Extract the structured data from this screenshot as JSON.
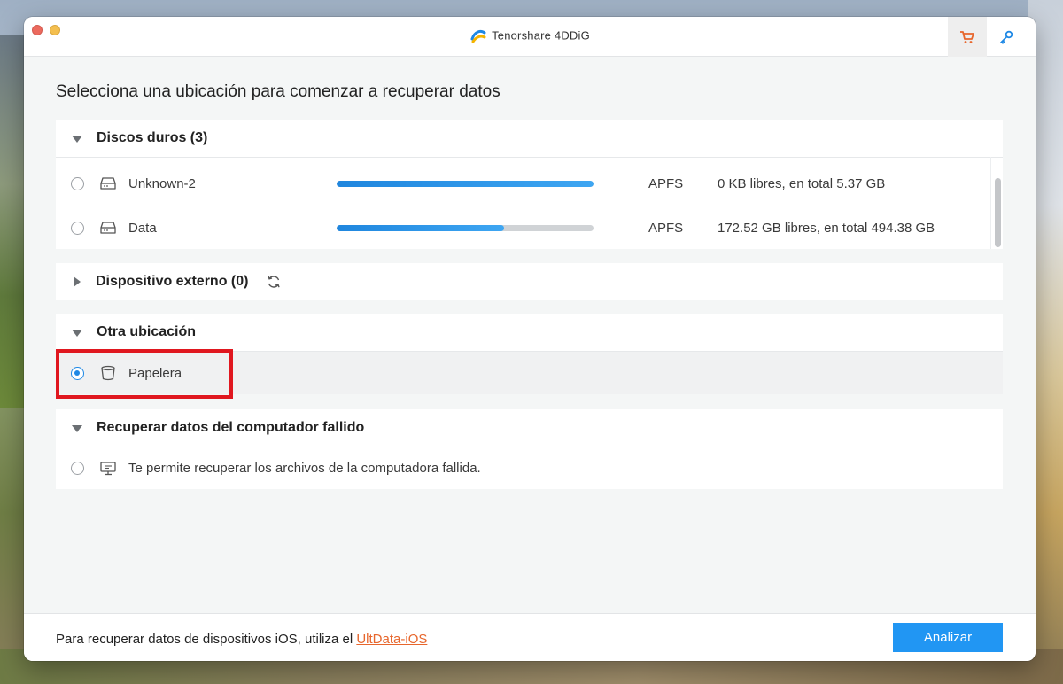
{
  "window": {
    "app_title": "Tenorshare 4DDiG"
  },
  "toolbar": {
    "cart_icon": "cart-icon",
    "key_icon": "key-icon"
  },
  "page": {
    "title": "Selecciona una ubicación para comenzar a recuperar datos"
  },
  "sections": {
    "hard_disks": {
      "title": "Discos duros (3)",
      "drives": [
        {
          "name": "Unknown-2",
          "filesystem": "APFS",
          "space": "0 KB libres, en total 5.37 GB",
          "used_fraction": 1.0,
          "selected": false
        },
        {
          "name": "Data",
          "filesystem": "APFS",
          "space": "172.52 GB libres, en total 494.38 GB",
          "used_fraction": 0.65,
          "selected": false
        }
      ]
    },
    "external": {
      "title": "Dispositivo externo (0)"
    },
    "other": {
      "title": "Otra ubicación",
      "items": [
        {
          "label": "Papelera",
          "selected": true
        }
      ]
    },
    "crashed": {
      "title": "Recuperar datos del computador fallido",
      "items": [
        {
          "label": "Te permite recuperar los archivos de la computadora fallida.",
          "selected": false
        }
      ]
    }
  },
  "footer": {
    "text": "Para recuperar datos de dispositivos iOS, utiliza el ",
    "link": "UltData-iOS",
    "analyze_button": "Analizar"
  },
  "colors": {
    "accent": "#2196f3",
    "link": "#e7662c",
    "highlight": "#e0171f"
  }
}
